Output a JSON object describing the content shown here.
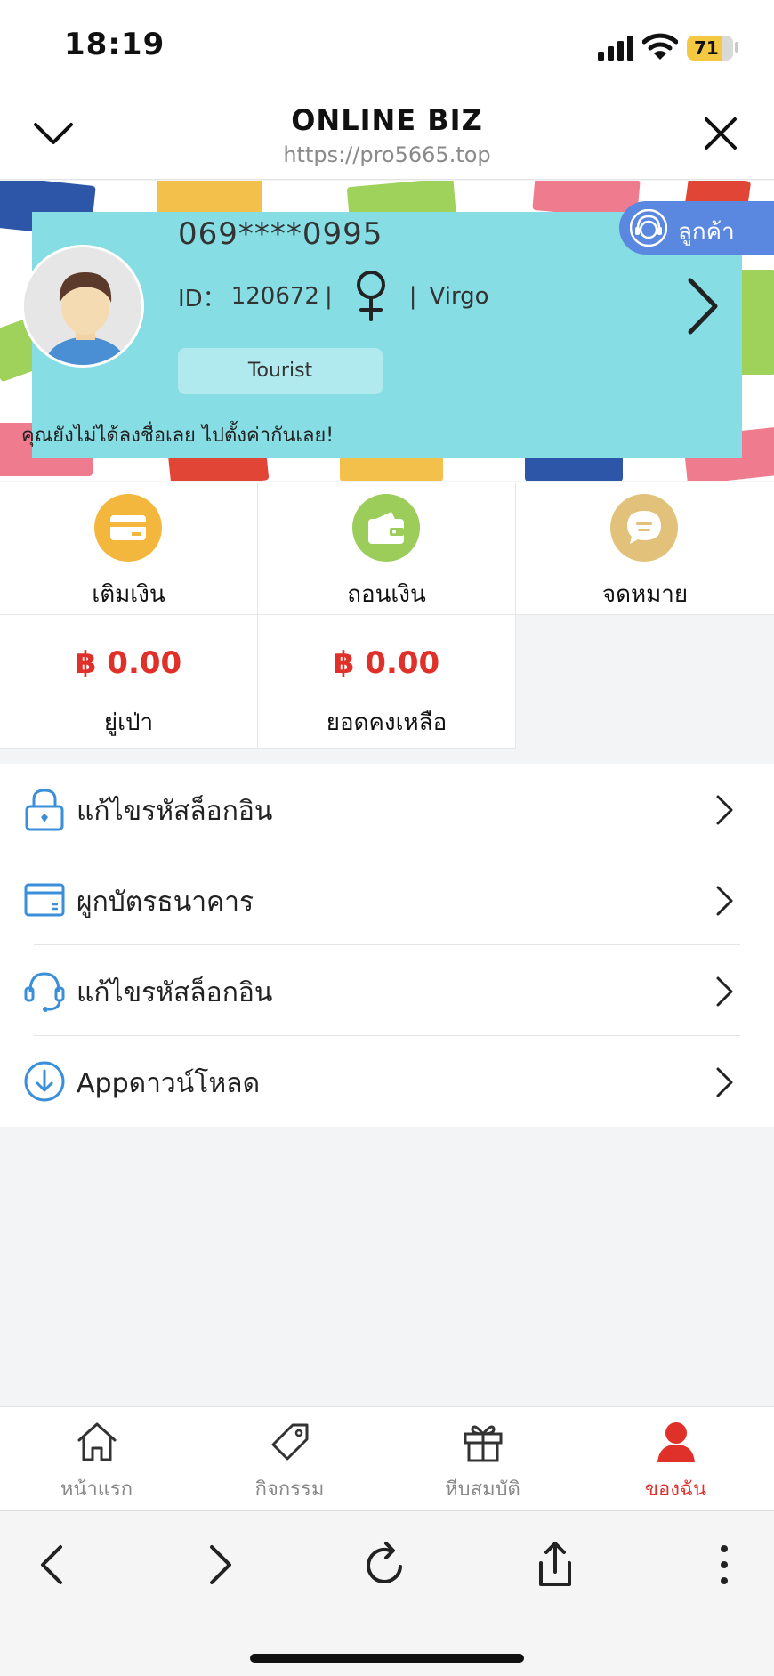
{
  "status_bar": {
    "time": "18:19",
    "battery": "71"
  },
  "browser": {
    "title": "ONLINE BIZ",
    "url": "https://pro5665.top"
  },
  "profile": {
    "phone": "069****0995",
    "id_label": "ID：",
    "id_value": "120672",
    "sep": "|",
    "zodiac": "Virgo",
    "gender_icon": "female-icon",
    "level_badge": "Tourist",
    "support_label": "ลูกค้า",
    "notice": "คุณยังไม่ได้ลงชื่อเลย ไปตั้งค่ากันเลย!"
  },
  "actions": [
    {
      "label": "เติมเงิน",
      "icon": "card-icon",
      "color": "#f3b73e"
    },
    {
      "label": "ถอนเงิน",
      "icon": "wallet-icon",
      "color": "#9ccc5a"
    },
    {
      "label": "จดหมาย",
      "icon": "message-icon",
      "color": "#e2c27a"
    }
  ],
  "balances": [
    {
      "amount": "฿ 0.00",
      "label": "ยู่เป่า"
    },
    {
      "amount": "฿ 0.00",
      "label": "ยอดคงเหลือ"
    }
  ],
  "menu": [
    {
      "label": "แก้ไขรหัสล็อกอิน",
      "icon": "lock-icon"
    },
    {
      "label": "ผูกบัตรธนาคาร",
      "icon": "bank-card-icon"
    },
    {
      "label": "แก้ไขรหัสล็อกอิน",
      "icon": "headset-icon"
    },
    {
      "label": "Appดาวน์โหลด",
      "icon": "download-icon"
    }
  ],
  "tabs": [
    {
      "label": "หน้าแรก",
      "icon": "home-icon",
      "active": false
    },
    {
      "label": "กิจกรรม",
      "icon": "tag-icon",
      "active": false
    },
    {
      "label": "หีบสมบัติ",
      "icon": "gift-icon",
      "active": false
    },
    {
      "label": "ของฉัน",
      "icon": "user-icon",
      "active": true
    }
  ],
  "colors": {
    "accent_red": "#e0302a",
    "card_teal": "#86dde4",
    "support_blue": "#5a87e0",
    "menu_icon_blue": "#3a8fd8"
  }
}
